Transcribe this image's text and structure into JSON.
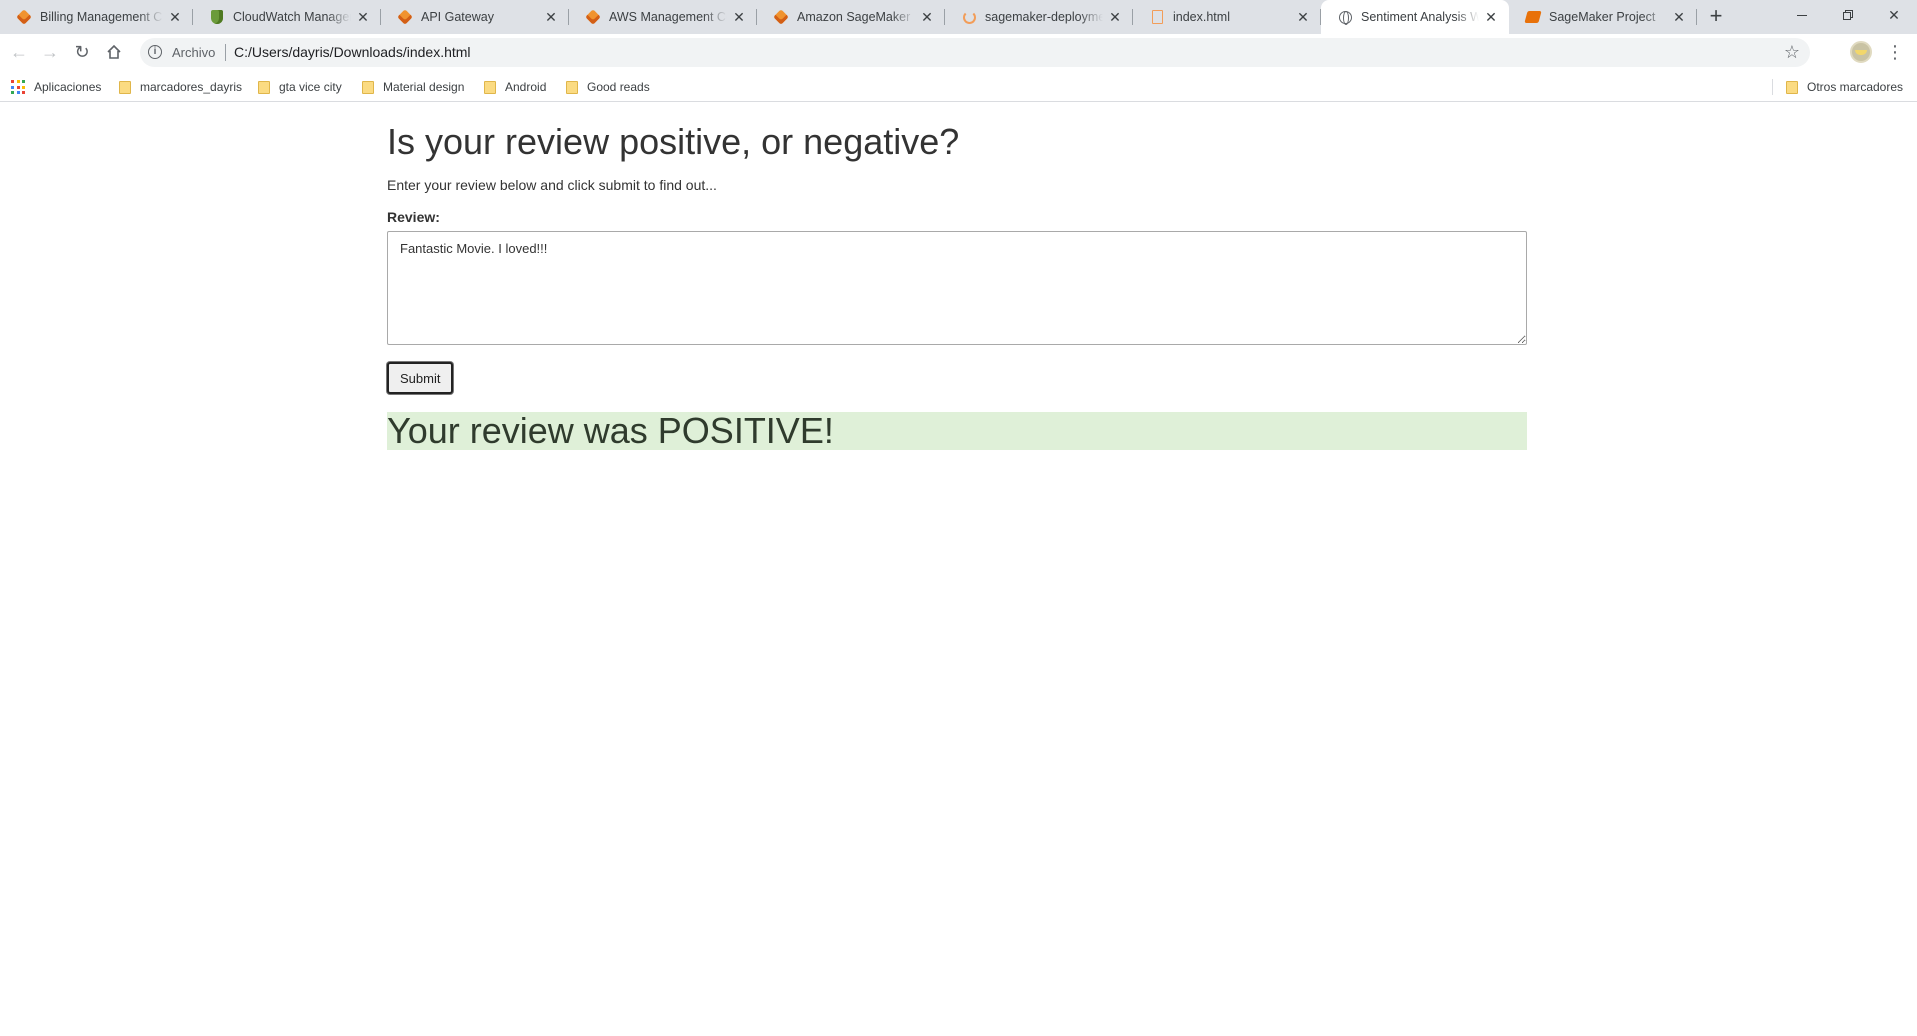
{
  "browser": {
    "tabs": [
      {
        "title": "Billing Management Co",
        "icon": "aws-icon"
      },
      {
        "title": "CloudWatch Managem",
        "icon": "cloudwatch-icon"
      },
      {
        "title": "API Gateway",
        "icon": "aws-icon"
      },
      {
        "title": "AWS Management Con",
        "icon": "aws-icon"
      },
      {
        "title": "Amazon SageMaker",
        "icon": "aws-icon"
      },
      {
        "title": "sagemaker-deploymen",
        "icon": "loading-spinner-icon"
      },
      {
        "title": "index.html",
        "icon": "file-icon"
      },
      {
        "title": "Sentiment Analysis We",
        "icon": "globe-icon",
        "active": true
      },
      {
        "title": "SageMaker Project",
        "icon": "sagemaker-notebook-icon"
      }
    ],
    "address": {
      "scheme_label": "Archivo",
      "url": "C:/Users/dayris/Downloads/index.html"
    },
    "bookmarks": {
      "apps_label": "Aplicaciones",
      "items": [
        "marcadores_dayris",
        "gta vice city",
        "Material design",
        "Android",
        "Good reads"
      ],
      "other_label": "Otros marcadores"
    }
  },
  "page": {
    "heading": "Is your review positive, or negative?",
    "lead": "Enter your review below and click submit to find out...",
    "review_label": "Review:",
    "review_value": "Fantastic Movie. I loved!!!",
    "submit_label": "Submit",
    "result_text": "Your review was POSITIVE!"
  },
  "colors": {
    "tabstrip_bg": "#dee1e6",
    "result_bg": "#dff0d8"
  }
}
